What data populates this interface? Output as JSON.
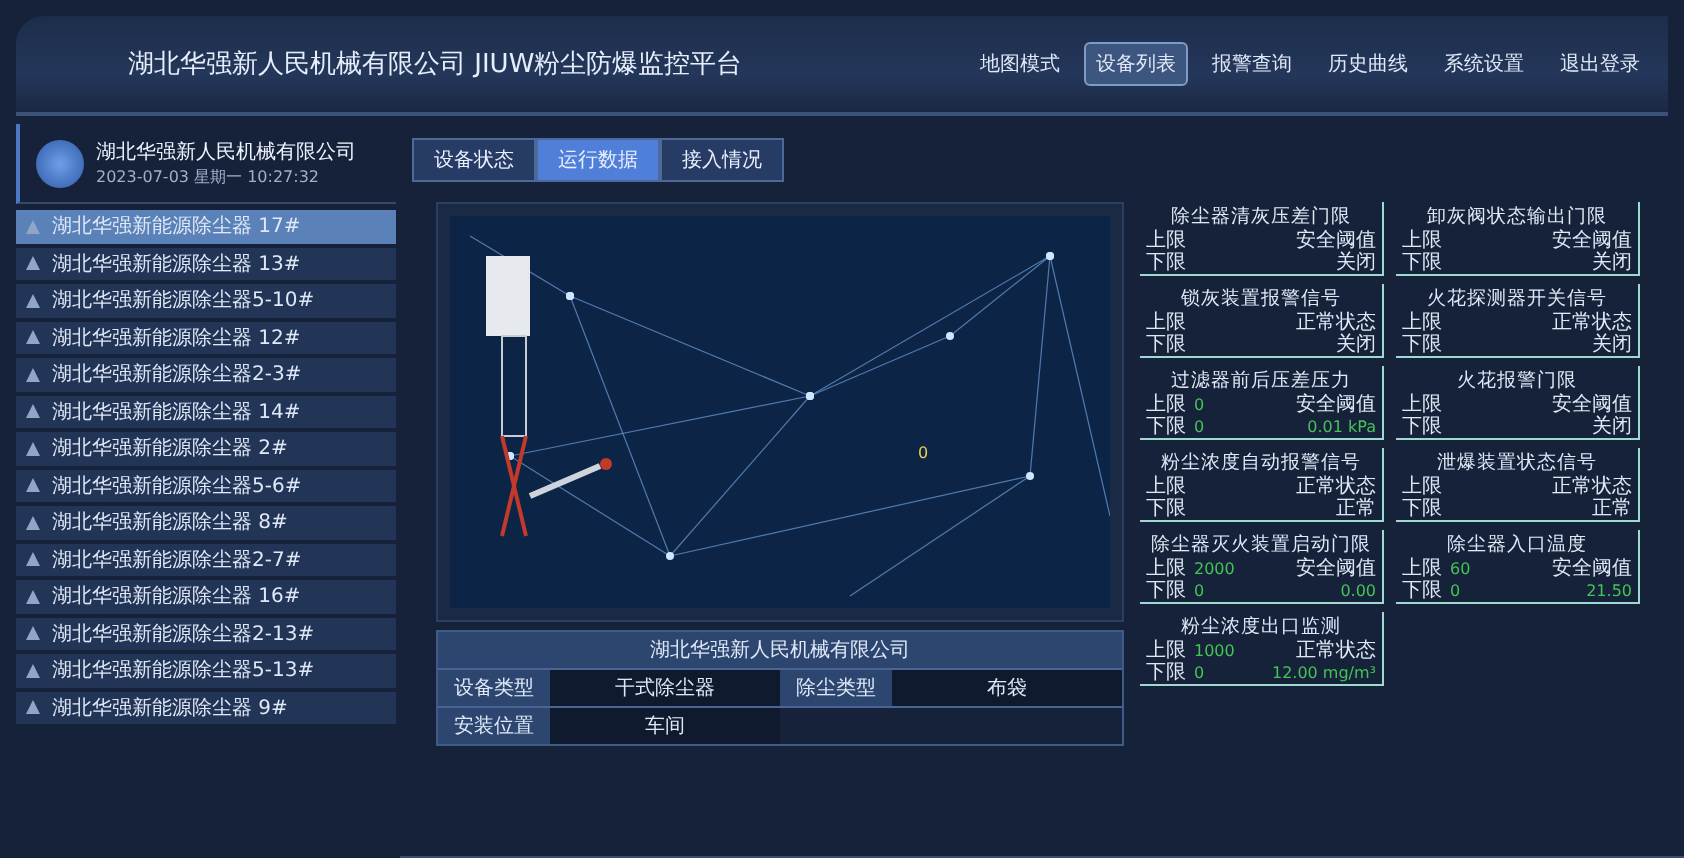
{
  "header": {
    "title": "湖北华强新人民机械有限公司 JIUW粉尘防爆监控平台",
    "nav": [
      {
        "label": "地图模式",
        "selected": false
      },
      {
        "label": "设备列表",
        "selected": true
      },
      {
        "label": "报警查询",
        "selected": false
      },
      {
        "label": "历史曲线",
        "selected": false
      },
      {
        "label": "系统设置",
        "selected": false
      },
      {
        "label": "退出登录",
        "selected": false
      }
    ]
  },
  "company": {
    "name": "湖北华强新人民机械有限公司",
    "datetime": "2023-07-03 星期一 10:27:32"
  },
  "devices": [
    {
      "name": "湖北华强新能源除尘器 17#",
      "selected": true
    },
    {
      "name": "湖北华强新能源除尘器 13#",
      "selected": false
    },
    {
      "name": "湖北华强新能源除尘器5-10#",
      "selected": false
    },
    {
      "name": "湖北华强新能源除尘器 12#",
      "selected": false
    },
    {
      "name": "湖北华强新能源除尘器2-3#",
      "selected": false
    },
    {
      "name": "湖北华强新能源除尘器 14#",
      "selected": false
    },
    {
      "name": "湖北华强新能源除尘器 2#",
      "selected": false
    },
    {
      "name": "湖北华强新能源除尘器5-6#",
      "selected": false
    },
    {
      "name": "湖北华强新能源除尘器 8#",
      "selected": false
    },
    {
      "name": "湖北华强新能源除尘器2-7#",
      "selected": false
    },
    {
      "name": "湖北华强新能源除尘器 16#",
      "selected": false
    },
    {
      "name": "湖北华强新能源除尘器2-13#",
      "selected": false
    },
    {
      "name": "湖北华强新能源除尘器5-13#",
      "selected": false
    },
    {
      "name": "湖北华强新能源除尘器 9#",
      "selected": false
    }
  ],
  "tabs": [
    {
      "label": "设备状态",
      "selected": false
    },
    {
      "label": "运行数据",
      "selected": true
    },
    {
      "label": "接入情况",
      "selected": false
    }
  ],
  "scene": {
    "marker": "0"
  },
  "info_table": {
    "title": "湖北华强新人民机械有限公司",
    "rows": [
      {
        "cells": [
          "设备类型",
          "干式除尘器",
          "除尘类型",
          "布袋"
        ]
      },
      {
        "cells": [
          "安装位置",
          "车间"
        ]
      }
    ]
  },
  "cards": [
    {
      "title": "除尘器清灰压差门限",
      "rows": [
        {
          "label": "上限",
          "limit": "",
          "status": "安全阈值",
          "live": false
        },
        {
          "label": "下限",
          "limit": "",
          "status": "关闭",
          "live": false
        }
      ]
    },
    {
      "title": "卸灰阀状态输出门限",
      "rows": [
        {
          "label": "上限",
          "limit": "",
          "status": "安全阈值",
          "live": false
        },
        {
          "label": "下限",
          "limit": "",
          "status": "关闭",
          "live": false
        }
      ]
    },
    {
      "title": "锁灰装置报警信号",
      "rows": [
        {
          "label": "上限",
          "limit": "",
          "status": "正常状态",
          "live": false
        },
        {
          "label": "下限",
          "limit": "",
          "status": "关闭",
          "live": false
        }
      ]
    },
    {
      "title": "火花探测器开关信号",
      "rows": [
        {
          "label": "上限",
          "limit": "",
          "status": "正常状态",
          "live": false
        },
        {
          "label": "下限",
          "limit": "",
          "status": "关闭",
          "live": false
        }
      ]
    },
    {
      "title": "过滤器前后压差压力",
      "rows": [
        {
          "label": "上限",
          "limit": "0",
          "status": "安全阈值",
          "live": false
        },
        {
          "label": "下限",
          "limit": "0",
          "status": "0.01 kPa",
          "live": true
        }
      ]
    },
    {
      "title": "火花报警门限",
      "rows": [
        {
          "label": "上限",
          "limit": "",
          "status": "安全阈值",
          "live": false
        },
        {
          "label": "下限",
          "limit": "",
          "status": "关闭",
          "live": false
        }
      ]
    },
    {
      "title": "粉尘浓度自动报警信号",
      "rows": [
        {
          "label": "上限",
          "limit": "",
          "status": "正常状态",
          "live": false
        },
        {
          "label": "下限",
          "limit": "",
          "status": "正常",
          "live": false
        }
      ]
    },
    {
      "title": "泄爆装置状态信号",
      "rows": [
        {
          "label": "上限",
          "limit": "",
          "status": "正常状态",
          "live": false
        },
        {
          "label": "下限",
          "limit": "",
          "status": "正常",
          "live": false
        }
      ]
    },
    {
      "title": "除尘器灭火装置启动门限",
      "rows": [
        {
          "label": "上限",
          "limit": "2000",
          "status": "安全阈值",
          "live": false
        },
        {
          "label": "下限",
          "limit": "0",
          "status": "0.00",
          "live": true
        }
      ]
    },
    {
      "title": "除尘器入口温度",
      "rows": [
        {
          "label": "上限",
          "limit": "60",
          "status": "安全阈值",
          "live": false
        },
        {
          "label": "下限",
          "limit": "0",
          "status": "21.50",
          "live": true
        }
      ]
    },
    {
      "title": "粉尘浓度出口监测",
      "rows": [
        {
          "label": "上限",
          "limit": "1000",
          "status": "正常状态",
          "live": false
        },
        {
          "label": "下限",
          "limit": "0",
          "status": "12.00 mg/m³",
          "live": true
        }
      ]
    }
  ]
}
